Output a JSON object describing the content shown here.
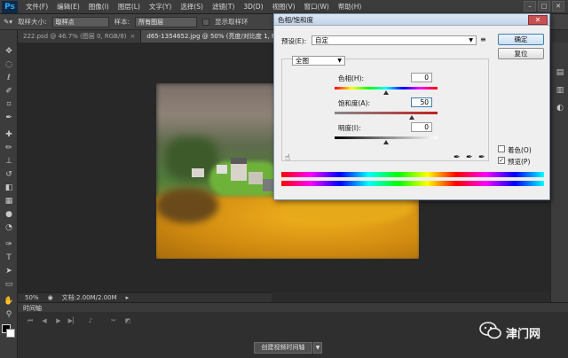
{
  "app": {
    "logo": "Ps",
    "menu": [
      "文件(F)",
      "编辑(E)",
      "图像(I)",
      "图层(L)",
      "文字(Y)",
      "选择(S)",
      "滤镜(T)",
      "3D(D)",
      "视图(V)",
      "窗口(W)",
      "帮助(H)"
    ],
    "window_controls": [
      "–",
      "□",
      "✕"
    ]
  },
  "options_bar": {
    "sample_size_label": "取样大小:",
    "sample_size_value": "取样点",
    "sample_label": "样本:",
    "sample_value": "所有图层",
    "show_ring_label": "显示取样环"
  },
  "tabs": [
    {
      "label": "222.psd @ 46.7% (图层 0, RGB/8)",
      "active": false
    },
    {
      "label": "d65-1354652.jpg @ 50% (亮度/对比度 1, RGB/8)",
      "active": true
    }
  ],
  "tools": [
    "move-icon",
    "marquee-icon",
    "lasso-icon",
    "quick-select-icon",
    "crop-icon",
    "eyedropper-icon",
    "healing-icon",
    "brush-icon",
    "stamp-icon",
    "history-brush-icon",
    "eraser-icon",
    "gradient-icon",
    "blur-icon",
    "dodge-icon",
    "pen-icon",
    "type-icon",
    "path-select-icon",
    "shape-icon",
    "hand-icon",
    "zoom-icon"
  ],
  "status": {
    "zoom": "50%",
    "doc_info": "文档:2.00M/2.00M"
  },
  "timeline": {
    "title": "时间轴",
    "create_button": "创建视频时间轴"
  },
  "dialog": {
    "title": "色相/饱和度",
    "preset_label": "预设(E):",
    "preset_value": "自定",
    "channel_value": "全图",
    "hue_label": "色相(H):",
    "hue_value": "0",
    "saturation_label": "饱和度(A):",
    "saturation_value": "50",
    "lightness_label": "明度(I):",
    "lightness_value": "0",
    "ok_button": "确定",
    "reset_button": "复位",
    "colorize_label": "着色(O)",
    "colorize_checked": false,
    "preview_label": "预览(P)",
    "preview_checked": true
  },
  "watermark": {
    "text": "津门网"
  },
  "colors": {
    "accent": "#3c7fb1",
    "dialog_bg": "#efefef",
    "close_button": "#c75050"
  }
}
